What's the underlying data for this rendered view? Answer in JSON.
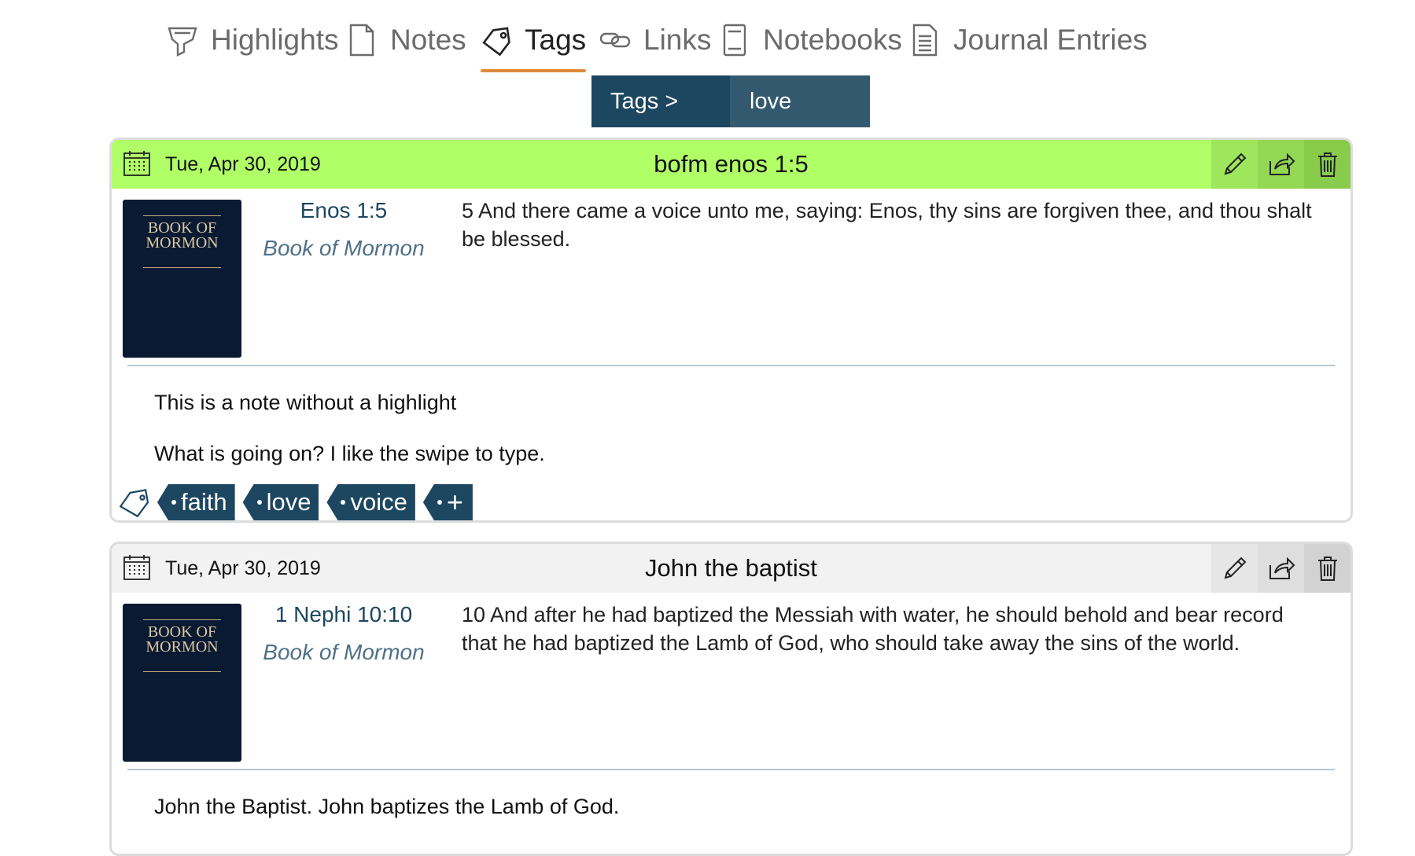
{
  "tabs": [
    {
      "label": "Highlights",
      "icon": "highlighter-icon"
    },
    {
      "label": "Notes",
      "icon": "note-icon"
    },
    {
      "label": "Tags",
      "icon": "tag-icon",
      "active": true
    },
    {
      "label": "Links",
      "icon": "link-icon"
    },
    {
      "label": "Notebooks",
      "icon": "notebook-icon"
    },
    {
      "label": "Journal Entries",
      "icon": "journal-icon"
    }
  ],
  "breadcrumb": {
    "root": "Tags >",
    "current": "love"
  },
  "colors": {
    "accent": "#1d4660",
    "highlight_green": "#b0ff66",
    "tab_underline": "#e08a3a"
  },
  "cards": [
    {
      "date": "Tue, Apr 30, 2019",
      "title": "bofm enos 1:5",
      "book_cover": "BOOK OF MORMON",
      "reference": "Enos 1:5",
      "book": "Book of Mormon",
      "verse": "5 And there came a voice unto me, saying: Enos, thy sins are forgiven thee, and thou shalt be blessed.",
      "note_lines": [
        "This is a note without a highlight",
        "What is going on? I like the swipe to type."
      ],
      "tags": [
        "faith",
        "love",
        "voice"
      ],
      "add_tag": "+"
    },
    {
      "date": "Tue, Apr 30, 2019",
      "title": "John the baptist",
      "book_cover": "BOOK OF MORMON",
      "reference": "1 Nephi 10:10",
      "book": "Book of Mormon",
      "verse": "10 And after he had baptized the Messiah with water, he should behold and bear record that he had baptized the Lamb of God, who should take away the sins of the world.",
      "note_lines": [
        "John the Baptist. John baptizes the Lamb of God."
      ]
    }
  ]
}
